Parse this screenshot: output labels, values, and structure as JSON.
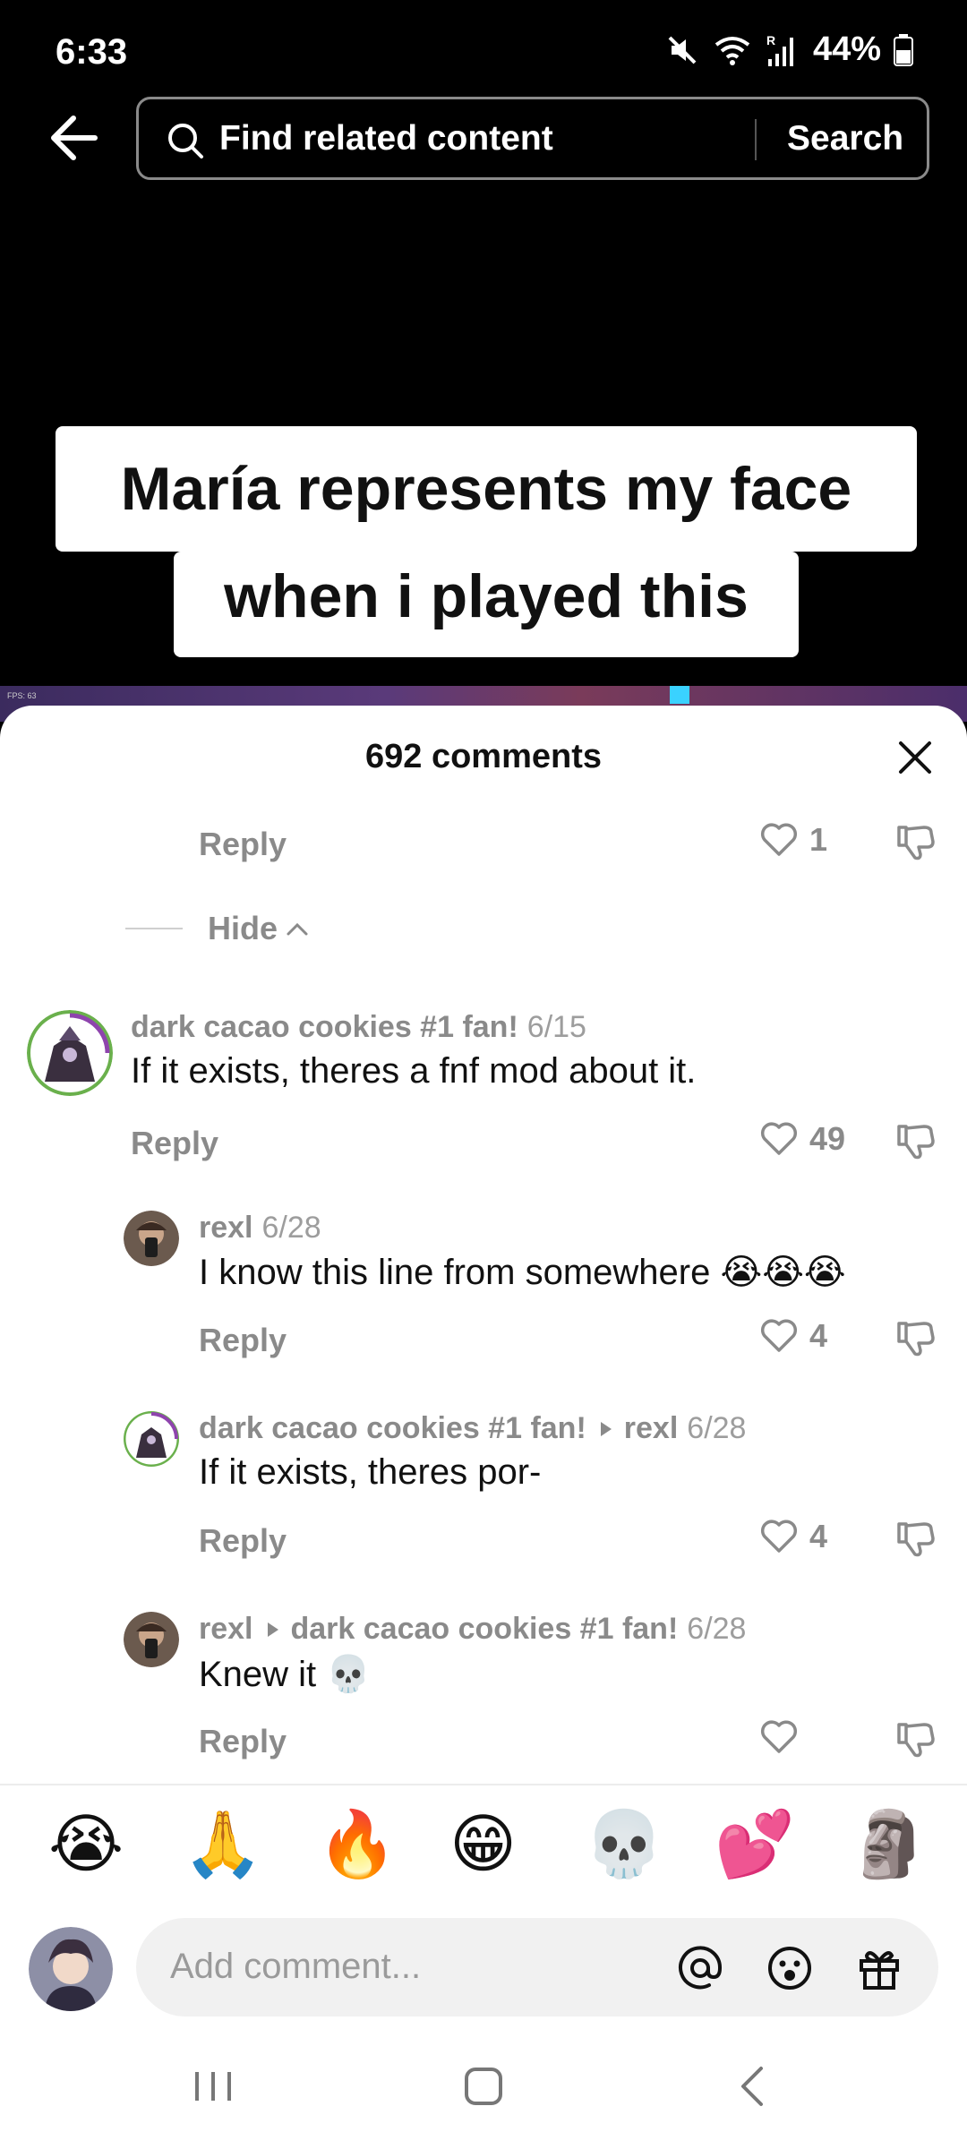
{
  "status": {
    "time": "6:33",
    "battery": "44%"
  },
  "search": {
    "placeholder": "Find related content",
    "button": "Search"
  },
  "video": {
    "caption_line1": "María represents my face",
    "caption_line2": "when i played this",
    "fps_text": "FPS: 63"
  },
  "comments": {
    "title": "692 comments",
    "top_reply": {
      "reply_label": "Reply",
      "likes": "1"
    },
    "hide_label": "Hide",
    "items": [
      {
        "author": "dark cacao cookies #1 fan!",
        "reply_to": "",
        "date": "6/15",
        "text": "If it exists, theres a fnf mod about it.",
        "emoji": "",
        "reply_label": "Reply",
        "likes": "49"
      },
      {
        "author": "rexl",
        "reply_to": "",
        "date": "6/28",
        "text": "I know this line from somewhere",
        "emoji": "😭😭😭",
        "reply_label": "Reply",
        "likes": "4"
      },
      {
        "author": "dark cacao cookies #1 fan!",
        "reply_to": "rexl",
        "date": "6/28",
        "text": "If it exists, theres por-",
        "emoji": "",
        "reply_label": "Reply",
        "likes": "4"
      },
      {
        "author": "rexl",
        "reply_to": "dark cacao cookies #1 fan!",
        "date": "6/28",
        "text": "Knew it",
        "emoji": "💀",
        "reply_label": "Reply",
        "likes": ""
      }
    ]
  },
  "quick_emojis": [
    "😭",
    "🙏",
    "🔥",
    "😁",
    "💀",
    "💕",
    "🗿"
  ],
  "input": {
    "placeholder": "Add comment..."
  },
  "icons": {
    "back": "arrow-left-icon",
    "search": "search-icon",
    "close": "close-icon",
    "like": "heart-icon",
    "dislike": "thumbs-down-icon",
    "mention": "at-icon",
    "emoji": "smiley-icon",
    "gift": "gift-icon"
  },
  "colors": {
    "sheet_bg": "#ffffff",
    "muted_text": "#8a8a8a",
    "input_bg": "#f1f1f1"
  }
}
